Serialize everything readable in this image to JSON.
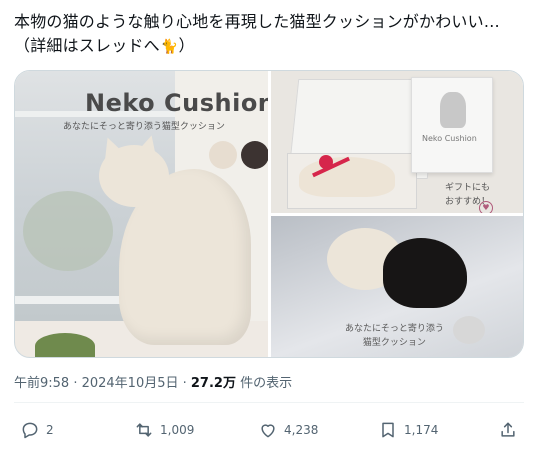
{
  "post": {
    "text": "本物の猫のような触り心地を再現した猫型クッションがかわいい…（詳細はスレッドへ",
    "text_tail": "）",
    "emoji_icon": "cat-emoji-icon"
  },
  "media": {
    "main": {
      "title": "Neko Cushion",
      "subtitle": "あなたにそっと寄り添う猫型クッション",
      "swatch_colors": [
        "#e7ddd0",
        "#3c3331"
      ]
    },
    "top_right": {
      "box_label": "Neko Cushion",
      "gift_line1": "ギフトにも",
      "gift_line2": "おすすめ！",
      "badge": "♥"
    },
    "bottom_right": {
      "line1": "あなたにそっと寄り添う",
      "line2": "猫型クッション"
    }
  },
  "meta": {
    "time": "午前9:58 · 2024年10月5日 · ",
    "views": "27.2万",
    "views_suffix": " 件の表示"
  },
  "actions": {
    "reply_count": "2",
    "retweet_count": "1,009",
    "like_count": "4,238",
    "bookmark_count": "1,174"
  },
  "colors": {
    "text": "#0f1419",
    "secondary": "#536471",
    "ribbon": "#d6264b"
  }
}
